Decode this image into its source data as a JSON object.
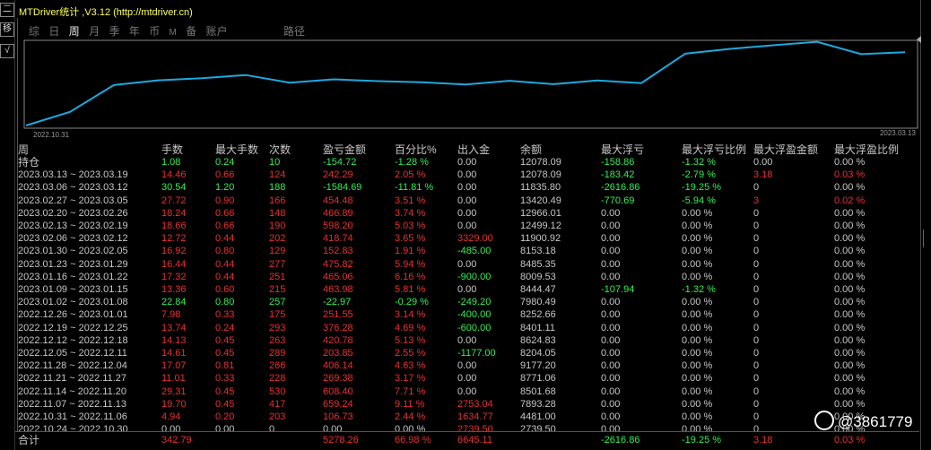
{
  "window": {
    "title": "MTDriver统计 ,V3.12 (http://mtdriver.cn)"
  },
  "left_edge": {
    "buttons": [
      "二",
      "移",
      "√"
    ]
  },
  "tabs": [
    {
      "label": "综",
      "active": false
    },
    {
      "label": "日",
      "active": false
    },
    {
      "label": "周",
      "active": true
    },
    {
      "label": "月",
      "active": false
    },
    {
      "label": "季",
      "active": false
    },
    {
      "label": "年",
      "active": false
    },
    {
      "label": "币",
      "active": false
    },
    {
      "label": "M",
      "active": false
    },
    {
      "label": "备",
      "active": false
    },
    {
      "label": "账户",
      "active": false
    },
    {
      "label": "路径",
      "active": false
    }
  ],
  "chart_data": {
    "type": "line",
    "x_start_label": "2022.10.31",
    "x_end_label": "2023.03.13",
    "series": [
      {
        "values": [
          2739.5,
          4481.0,
          7893.28,
          8501.68,
          8771.06,
          9177.2,
          8204.05,
          8624.83,
          8401.11,
          8252.66,
          7980.49,
          8444.47,
          8009.53,
          8485.35,
          8153.18,
          11900.92,
          12499.12,
          12966.01,
          13420.49,
          11835.8,
          12078.09
        ]
      }
    ],
    "ylim": [
      2400,
      13600
    ],
    "color": "#1ea8e0"
  },
  "table": {
    "headers": [
      "周",
      "手数",
      "最大手数",
      "次数",
      "盈亏金额",
      "百分比%",
      "出入金",
      "余额",
      "最大浮亏",
      "最大浮亏比例",
      "最大浮盈金额",
      "最大浮盈比例"
    ],
    "rows": [
      {
        "c": "g",
        "cells": [
          "持仓",
          "1.08",
          "0.24",
          "10",
          "-154.72",
          "-1.28 %",
          "0.00",
          "12078.09",
          "-158.86",
          "-1.32 %",
          "0.00",
          "0.00 %"
        ]
      },
      {
        "c": "r",
        "cells": [
          "2023.03.13 ~ 2023.03.19",
          "14.46",
          "0.66",
          "124",
          "242.29",
          "2.05 %",
          "0.00",
          "12078.09",
          "-183.42",
          "-2.79 %",
          "3.18",
          "0.03 %"
        ]
      },
      {
        "c": "g",
        "cells": [
          "2023.03.06 ~ 2023.03.12",
          "30.54",
          "1.20",
          "188",
          "-1584.69",
          "-11.81 %",
          "0.00",
          "11835.80",
          "-2616.86",
          "-19.25 %",
          "0",
          "0.00 %"
        ]
      },
      {
        "c": "r",
        "cells": [
          "2023.02.27 ~ 2023.03.05",
          "27.72",
          "0.90",
          "166",
          "454.48",
          "3.51 %",
          "0.00",
          "13420.49",
          "-770.69",
          "-5.94 %",
          "3",
          "0.02 %"
        ]
      },
      {
        "c": "r",
        "cells": [
          "2023.02.20 ~ 2023.02.26",
          "18.24",
          "0.66",
          "148",
          "466.89",
          "3.74 %",
          "0.00",
          "12966.01",
          "0.00",
          "0.00 %",
          "0",
          "0.00 %"
        ]
      },
      {
        "c": "r",
        "cells": [
          "2023.02.13 ~ 2023.02.19",
          "18.66",
          "0.66",
          "190",
          "598.20",
          "5.03 %",
          "0.00",
          "12499.12",
          "0.00",
          "0.00 %",
          "0",
          "0.00 %"
        ]
      },
      {
        "c": "r",
        "cells": [
          "2023.02.06 ~ 2023.02.12",
          "12.72",
          "0.44",
          "202",
          "418.74",
          "3.65 %",
          "3329.00",
          "11900.92",
          "0.00",
          "0.00 %",
          "0",
          "0.00 %"
        ]
      },
      {
        "c": "r",
        "cells": [
          "2023.01.30 ~ 2023.02.05",
          "16.92",
          "0.80",
          "129",
          "152.83",
          "1.91 %",
          "-485.00",
          "8153.18",
          "0.00",
          "0.00 %",
          "0",
          "0.00 %"
        ]
      },
      {
        "c": "r",
        "cells": [
          "2023.01.23 ~ 2023.01.29",
          "16.44",
          "0.44",
          "277",
          "475.82",
          "5.94 %",
          "0.00",
          "8485.35",
          "0.00",
          "0.00 %",
          "0",
          "0.00 %"
        ]
      },
      {
        "c": "r",
        "cells": [
          "2023.01.16 ~ 2023.01.22",
          "17.32",
          "0.44",
          "251",
          "465.06",
          "6.16 %",
          "-900.00",
          "8009.53",
          "0.00",
          "0.00 %",
          "0",
          "0.00 %"
        ]
      },
      {
        "c": "r",
        "cells": [
          "2023.01.09 ~ 2023.01.15",
          "13.36",
          "0.60",
          "215",
          "463.98",
          "5.81 %",
          "0.00",
          "8444.47",
          "-107.94",
          "-1.32 %",
          "0",
          "0.00 %"
        ]
      },
      {
        "c": "g",
        "cells": [
          "2023.01.02 ~ 2023.01.08",
          "22.84",
          "0.80",
          "257",
          "-22.97",
          "-0.29 %",
          "-249.20",
          "7980.49",
          "0.00",
          "0.00 %",
          "0",
          "0.00 %"
        ]
      },
      {
        "c": "r",
        "cells": [
          "2022.12.26 ~ 2023.01.01",
          "7.98",
          "0.33",
          "175",
          "251.55",
          "3.14 %",
          "-400.00",
          "8252.66",
          "0.00",
          "0.00 %",
          "0",
          "0.00 %"
        ]
      },
      {
        "c": "r",
        "cells": [
          "2022.12.19 ~ 2022.12.25",
          "13.74",
          "0.24",
          "293",
          "376.28",
          "4.69 %",
          "-600.00",
          "8401.11",
          "0.00",
          "0.00 %",
          "0",
          "0.00 %"
        ]
      },
      {
        "c": "r",
        "cells": [
          "2022.12.12 ~ 2022.12.18",
          "14.13",
          "0.45",
          "263",
          "420.78",
          "5.13 %",
          "0.00",
          "8624.83",
          "0.00",
          "0.00 %",
          "0",
          "0.00 %"
        ]
      },
      {
        "c": "r",
        "cells": [
          "2022.12.05 ~ 2022.12.11",
          "14.61",
          "0.45",
          "289",
          "203.85",
          "2.55 %",
          "-1177.00",
          "8204.05",
          "0.00",
          "0.00 %",
          "0",
          "0.00 %"
        ]
      },
      {
        "c": "r",
        "cells": [
          "2022.11.28 ~ 2022.12.04",
          "17.07",
          "0.81",
          "266",
          "406.14",
          "4.63 %",
          "0.00",
          "9177.20",
          "0.00",
          "0.00 %",
          "0",
          "0.00 %"
        ]
      },
      {
        "c": "r",
        "cells": [
          "2022.11.21 ~ 2022.11.27",
          "11.01",
          "0.33",
          "228",
          "269.38",
          "3.17 %",
          "0.00",
          "8771.06",
          "0.00",
          "0.00 %",
          "0",
          "0.00 %"
        ]
      },
      {
        "c": "r",
        "cells": [
          "2022.11.14 ~ 2022.11.20",
          "29.31",
          "0.45",
          "530",
          "608.40",
          "7.71 %",
          "0.00",
          "8501.68",
          "0.00",
          "0.00 %",
          "0",
          "0.00 %"
        ]
      },
      {
        "c": "r",
        "cells": [
          "2022.11.07 ~ 2022.11.13",
          "19.70",
          "0.45",
          "417",
          "659.24",
          "9.11 %",
          "2753.04",
          "7893.28",
          "0.00",
          "0.00 %",
          "0",
          "0.00 %"
        ]
      },
      {
        "c": "r",
        "cells": [
          "2022.10.31 ~ 2022.11.06",
          "4.94",
          "0.20",
          "203",
          "106.73",
          "2.44 %",
          "1634.77",
          "4481.00",
          "0.00",
          "0.00 %",
          "0",
          "0.00 %"
        ]
      },
      {
        "c": "w",
        "cells": [
          "2022.10.24 ~ 2022.10.30",
          "0.00",
          "0.00",
          "0",
          "0.00",
          "0.00 %",
          "2739.50",
          "2739.50",
          "0.00",
          "0.00 %",
          "0",
          "0.00 %"
        ]
      }
    ],
    "total": {
      "cells": [
        "合计",
        "342.79",
        "",
        "",
        "5278.26",
        "66.98 %",
        "6645.11",
        "",
        "-2616.86",
        "-19.25 %",
        "3.18",
        "0.03 %"
      ]
    }
  },
  "colors": {
    "profit": "#e83030",
    "loss": "#33ee55",
    "neutral": "#c8c8c8",
    "accent": "#ffff55"
  },
  "watermark": {
    "icon": "weibo-icon",
    "text": "@3861779"
  }
}
